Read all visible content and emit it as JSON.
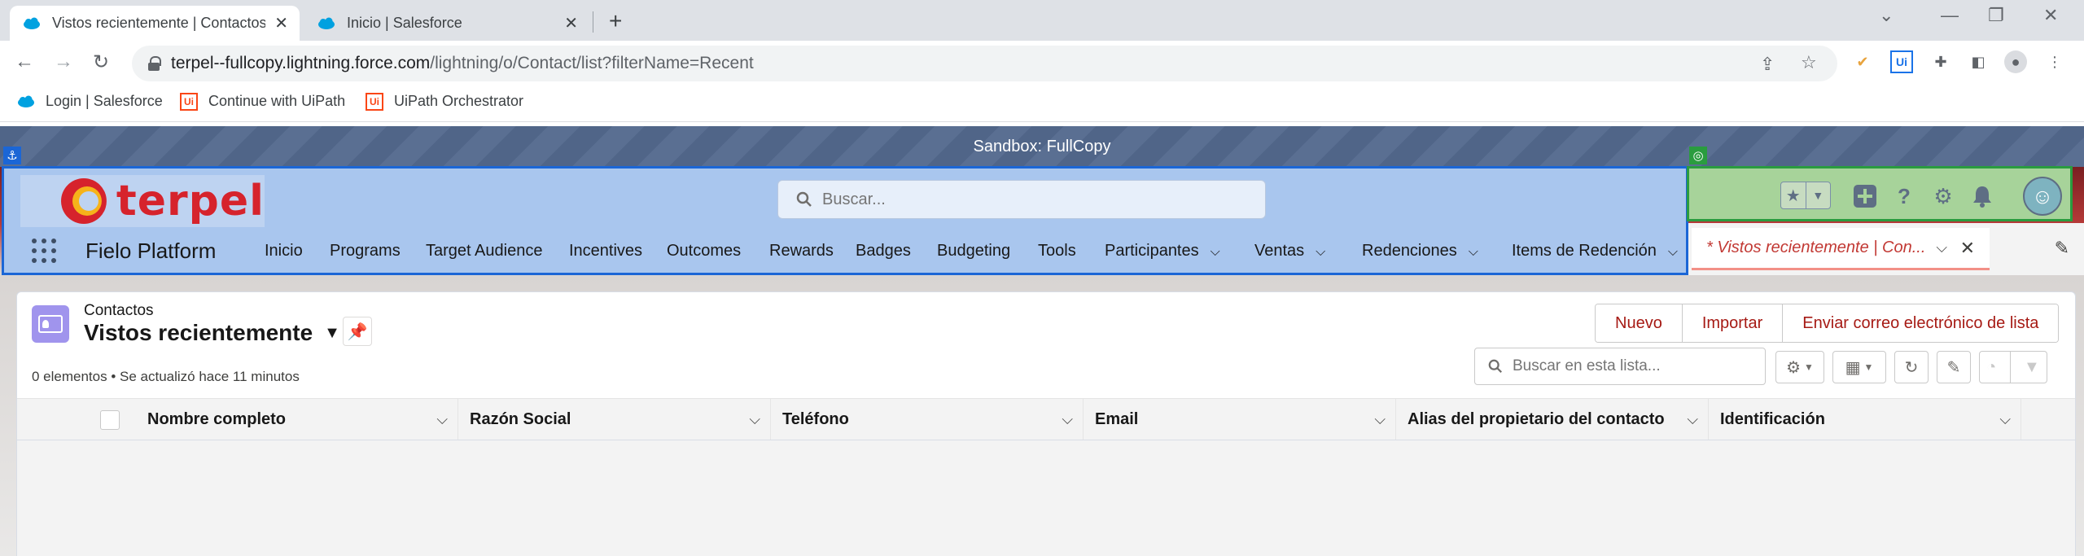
{
  "browser": {
    "tabs": [
      {
        "title": "Vistos recientemente | Contactos",
        "active": true
      },
      {
        "title": "Inicio | Salesforce",
        "active": false
      }
    ],
    "url_host": "terpel--fullcopy.lightning.force.com",
    "url_path": "/lightning/o/Contact/list?filterName=Recent",
    "bookmarks": [
      "Login | Salesforce",
      "Continue with UiPath",
      "UiPath Orchestrator"
    ]
  },
  "sandbox_label": "Sandbox: FullCopy",
  "header": {
    "logo_text": "terpel",
    "search_placeholder": "Buscar...",
    "app_name": "Fielo Platform",
    "nav_items": [
      {
        "label": "Inicio"
      },
      {
        "label": "Programs"
      },
      {
        "label": "Target Audience"
      },
      {
        "label": "Incentives"
      },
      {
        "label": "Outcomes"
      },
      {
        "label": "Rewards"
      },
      {
        "label": "Badges"
      },
      {
        "label": "Budgeting"
      },
      {
        "label": "Tools"
      },
      {
        "label": "Participantes",
        "dropdown": true
      },
      {
        "label": "Ventas",
        "dropdown": true
      },
      {
        "label": "Redenciones",
        "dropdown": true
      },
      {
        "label": "Items de Redención",
        "dropdown": true
      }
    ],
    "workspace_tab": "* Vistos recientemente | Con..."
  },
  "list": {
    "object_label": "Contactos",
    "title": "Vistos recientemente",
    "buttons": [
      "Nuevo",
      "Importar",
      "Enviar correo electrónico de lista"
    ],
    "status": "0 elementos • Se actualizó hace 11 minutos",
    "search_placeholder": "Buscar en esta lista...",
    "columns": [
      "Nombre completo",
      "Razón Social",
      "Teléfono",
      "Email",
      "Alias del propietario del contacto",
      "Identificación"
    ],
    "rows": []
  },
  "colors": {
    "header_highlight": "#a9c6ee",
    "controls_highlight": "#a7d39a",
    "brand_red": "#d6232c",
    "button_text": "#a61a14",
    "object_icon": "#a094ed"
  },
  "icons": [
    "salesforce-cloud-icon",
    "lock-icon",
    "search-icon",
    "waffle-icon",
    "favorite-star-icon",
    "add-icon",
    "help-icon",
    "setup-gear-icon",
    "notification-bell-icon",
    "pin-icon",
    "refresh-icon",
    "edit-pencil-icon",
    "filter-icon",
    "chart-icon"
  ]
}
